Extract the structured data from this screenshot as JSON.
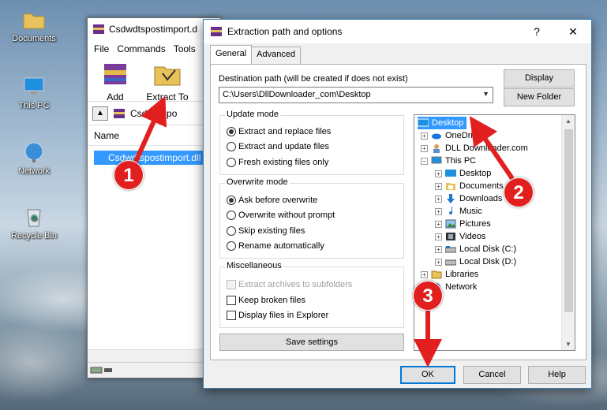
{
  "desktop": {
    "icons": [
      {
        "label": "Documents"
      },
      {
        "label": "This PC"
      },
      {
        "label": "Network"
      },
      {
        "label": "Recycle Bin"
      }
    ]
  },
  "winrar": {
    "title": "Csdwdtspostimport.d",
    "menu": [
      "File",
      "Commands",
      "Tools"
    ],
    "tools": [
      "Add",
      "Extract To"
    ],
    "address": "Csdwdtspo",
    "column_name": "Name",
    "file_name": "Csdwdtspostimport.dll"
  },
  "dialog": {
    "title": "Extraction path and options",
    "help_glyph": "?",
    "close_glyph": "✕",
    "tabs": [
      "General",
      "Advanced"
    ],
    "dest_label": "Destination path (will be created if does not exist)",
    "dest_value": "C:\\Users\\DllDownloader_com\\Desktop",
    "display_btn": "Display",
    "new_folder_btn": "New Folder",
    "update_mode": {
      "title": "Update mode",
      "options": [
        "Extract and replace files",
        "Extract and update files",
        "Fresh existing files only"
      ],
      "selected": 0
    },
    "overwrite_mode": {
      "title": "Overwrite mode",
      "options": [
        "Ask before overwrite",
        "Overwrite without prompt",
        "Skip existing files",
        "Rename automatically"
      ],
      "selected": 0
    },
    "misc": {
      "title": "Miscellaneous",
      "options": [
        "Extract archives to subfolders",
        "Keep broken files",
        "Display files in Explorer"
      ]
    },
    "save_settings": "Save settings",
    "tree": [
      {
        "label": "Desktop"
      },
      {
        "label": "OneDrive"
      },
      {
        "label": "DLL Downloader.com"
      },
      {
        "label": "This PC"
      },
      {
        "label": "Desktop"
      },
      {
        "label": "Documents"
      },
      {
        "label": "Downloads"
      },
      {
        "label": "Music"
      },
      {
        "label": "Pictures"
      },
      {
        "label": "Videos"
      },
      {
        "label": "Local Disk (C:)"
      },
      {
        "label": "Local Disk (D:)"
      },
      {
        "label": "Libraries"
      },
      {
        "label": "Network"
      }
    ],
    "ok": "OK",
    "cancel": "Cancel",
    "help": "Help"
  },
  "annotations": {
    "marks": [
      "1",
      "2",
      "3"
    ],
    "color": "#e21f1f"
  },
  "colors": {
    "selection": "#3399ff",
    "accent": "#0078d7"
  }
}
